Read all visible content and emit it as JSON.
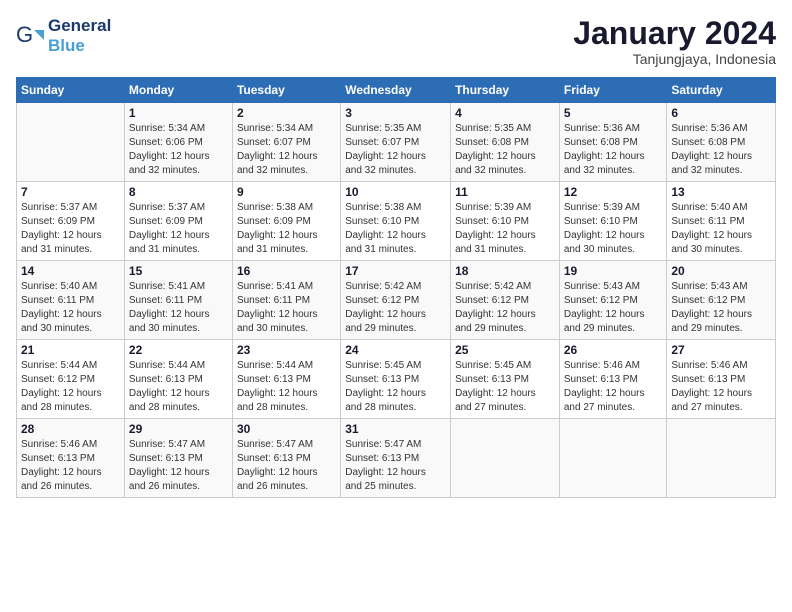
{
  "logo": {
    "text_general": "General",
    "text_blue": "Blue"
  },
  "title": "January 2024",
  "subtitle": "Tanjungjaya, Indonesia",
  "days_header": [
    "Sunday",
    "Monday",
    "Tuesday",
    "Wednesday",
    "Thursday",
    "Friday",
    "Saturday"
  ],
  "weeks": [
    [
      {
        "num": "",
        "info": ""
      },
      {
        "num": "1",
        "info": "Sunrise: 5:34 AM\nSunset: 6:06 PM\nDaylight: 12 hours\nand 32 minutes."
      },
      {
        "num": "2",
        "info": "Sunrise: 5:34 AM\nSunset: 6:07 PM\nDaylight: 12 hours\nand 32 minutes."
      },
      {
        "num": "3",
        "info": "Sunrise: 5:35 AM\nSunset: 6:07 PM\nDaylight: 12 hours\nand 32 minutes."
      },
      {
        "num": "4",
        "info": "Sunrise: 5:35 AM\nSunset: 6:08 PM\nDaylight: 12 hours\nand 32 minutes."
      },
      {
        "num": "5",
        "info": "Sunrise: 5:36 AM\nSunset: 6:08 PM\nDaylight: 12 hours\nand 32 minutes."
      },
      {
        "num": "6",
        "info": "Sunrise: 5:36 AM\nSunset: 6:08 PM\nDaylight: 12 hours\nand 32 minutes."
      }
    ],
    [
      {
        "num": "7",
        "info": "Sunrise: 5:37 AM\nSunset: 6:09 PM\nDaylight: 12 hours\nand 31 minutes."
      },
      {
        "num": "8",
        "info": "Sunrise: 5:37 AM\nSunset: 6:09 PM\nDaylight: 12 hours\nand 31 minutes."
      },
      {
        "num": "9",
        "info": "Sunrise: 5:38 AM\nSunset: 6:09 PM\nDaylight: 12 hours\nand 31 minutes."
      },
      {
        "num": "10",
        "info": "Sunrise: 5:38 AM\nSunset: 6:10 PM\nDaylight: 12 hours\nand 31 minutes."
      },
      {
        "num": "11",
        "info": "Sunrise: 5:39 AM\nSunset: 6:10 PM\nDaylight: 12 hours\nand 31 minutes."
      },
      {
        "num": "12",
        "info": "Sunrise: 5:39 AM\nSunset: 6:10 PM\nDaylight: 12 hours\nand 30 minutes."
      },
      {
        "num": "13",
        "info": "Sunrise: 5:40 AM\nSunset: 6:11 PM\nDaylight: 12 hours\nand 30 minutes."
      }
    ],
    [
      {
        "num": "14",
        "info": "Sunrise: 5:40 AM\nSunset: 6:11 PM\nDaylight: 12 hours\nand 30 minutes."
      },
      {
        "num": "15",
        "info": "Sunrise: 5:41 AM\nSunset: 6:11 PM\nDaylight: 12 hours\nand 30 minutes."
      },
      {
        "num": "16",
        "info": "Sunrise: 5:41 AM\nSunset: 6:11 PM\nDaylight: 12 hours\nand 30 minutes."
      },
      {
        "num": "17",
        "info": "Sunrise: 5:42 AM\nSunset: 6:12 PM\nDaylight: 12 hours\nand 29 minutes."
      },
      {
        "num": "18",
        "info": "Sunrise: 5:42 AM\nSunset: 6:12 PM\nDaylight: 12 hours\nand 29 minutes."
      },
      {
        "num": "19",
        "info": "Sunrise: 5:43 AM\nSunset: 6:12 PM\nDaylight: 12 hours\nand 29 minutes."
      },
      {
        "num": "20",
        "info": "Sunrise: 5:43 AM\nSunset: 6:12 PM\nDaylight: 12 hours\nand 29 minutes."
      }
    ],
    [
      {
        "num": "21",
        "info": "Sunrise: 5:44 AM\nSunset: 6:12 PM\nDaylight: 12 hours\nand 28 minutes."
      },
      {
        "num": "22",
        "info": "Sunrise: 5:44 AM\nSunset: 6:13 PM\nDaylight: 12 hours\nand 28 minutes."
      },
      {
        "num": "23",
        "info": "Sunrise: 5:44 AM\nSunset: 6:13 PM\nDaylight: 12 hours\nand 28 minutes."
      },
      {
        "num": "24",
        "info": "Sunrise: 5:45 AM\nSunset: 6:13 PM\nDaylight: 12 hours\nand 28 minutes."
      },
      {
        "num": "25",
        "info": "Sunrise: 5:45 AM\nSunset: 6:13 PM\nDaylight: 12 hours\nand 27 minutes."
      },
      {
        "num": "26",
        "info": "Sunrise: 5:46 AM\nSunset: 6:13 PM\nDaylight: 12 hours\nand 27 minutes."
      },
      {
        "num": "27",
        "info": "Sunrise: 5:46 AM\nSunset: 6:13 PM\nDaylight: 12 hours\nand 27 minutes."
      }
    ],
    [
      {
        "num": "28",
        "info": "Sunrise: 5:46 AM\nSunset: 6:13 PM\nDaylight: 12 hours\nand 26 minutes."
      },
      {
        "num": "29",
        "info": "Sunrise: 5:47 AM\nSunset: 6:13 PM\nDaylight: 12 hours\nand 26 minutes."
      },
      {
        "num": "30",
        "info": "Sunrise: 5:47 AM\nSunset: 6:13 PM\nDaylight: 12 hours\nand 26 minutes."
      },
      {
        "num": "31",
        "info": "Sunrise: 5:47 AM\nSunset: 6:13 PM\nDaylight: 12 hours\nand 25 minutes."
      },
      {
        "num": "",
        "info": ""
      },
      {
        "num": "",
        "info": ""
      },
      {
        "num": "",
        "info": ""
      }
    ]
  ]
}
